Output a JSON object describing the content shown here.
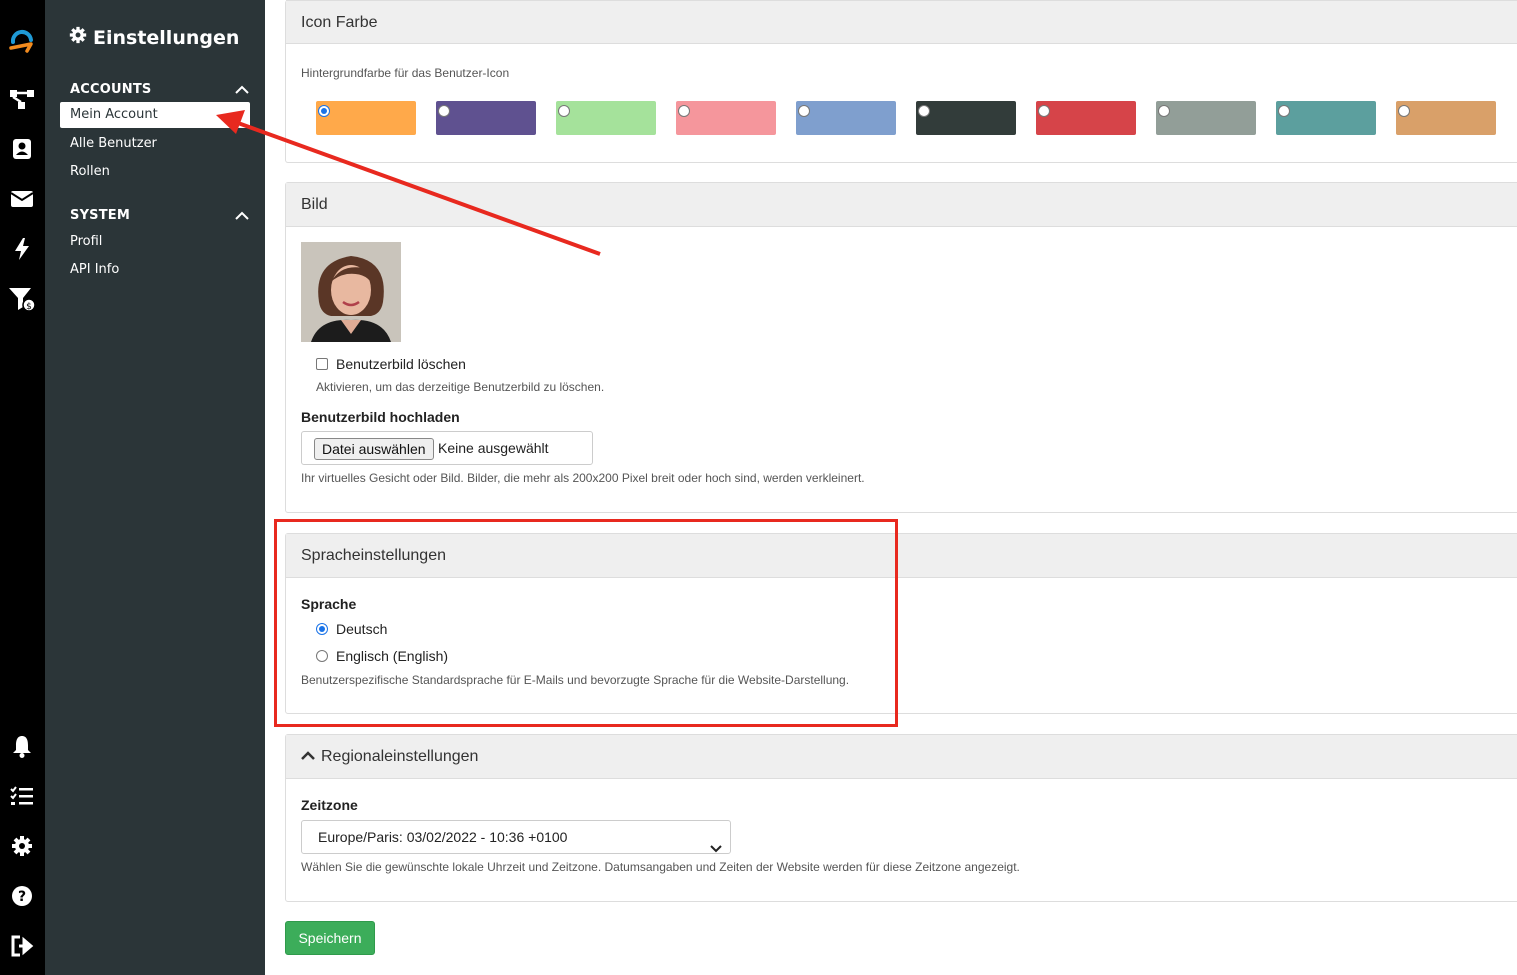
{
  "rail": {
    "icons": [
      "logo-icon",
      "workflow-icon",
      "contacts-icon",
      "mail-icon",
      "lightning-icon",
      "funnel-money-icon",
      "bell-icon",
      "checklist-icon",
      "gear-icon",
      "help-icon",
      "logout-icon"
    ]
  },
  "sidebar": {
    "title": "Einstellungen",
    "sections": [
      {
        "label": "ACCOUNTS",
        "items": [
          "Mein Account",
          "Alle Benutzer",
          "Rollen"
        ]
      },
      {
        "label": "SYSTEM",
        "items": [
          "Profil",
          "API Info"
        ]
      }
    ]
  },
  "icon_color": {
    "header": "Icon Farbe",
    "label": "Hintergrundfarbe für das Benutzer-Icon",
    "selected_index": 0,
    "swatches": [
      "#ffa94a",
      "#5f5190",
      "#a5e29b",
      "#f5969c",
      "#7f9fce",
      "#323c3a",
      "#d64449",
      "#929e98",
      "#5c9f9e",
      "#d9a069"
    ]
  },
  "image": {
    "header": "Bild",
    "delete_label": "Benutzerbild löschen",
    "delete_help": "Aktivieren, um das derzeitige Benutzerbild zu löschen.",
    "upload_label": "Benutzerbild hochladen",
    "file_button": "Datei auswählen",
    "file_status": "Keine ausgewählt",
    "upload_help": "Ihr virtuelles Gesicht oder Bild. Bilder, die mehr als 200x200 Pixel breit oder hoch sind, werden verkleinert."
  },
  "language": {
    "header": "Spracheinstellungen",
    "label": "Sprache",
    "options": [
      "Deutsch",
      "Englisch (English)"
    ],
    "selected": "Deutsch",
    "help": "Benutzerspezifische Standardsprache für E-Mails und bevorzugte Sprache für die Website-Darstellung."
  },
  "regional": {
    "header": "Regionaleinstellungen",
    "timezone_label": "Zeitzone",
    "timezone_value": "Europe/Paris: 03/02/2022 - 10:36 +0100",
    "help": "Wählen Sie die gewünschte lokale Uhrzeit und Zeitzone. Datumsangaben und Zeiten der Website werden für diese Zeitzone angezeigt."
  },
  "save_label": "Speichern",
  "colors": {
    "rail_bg": "#000000",
    "sidebar_bg": "#2b3538",
    "save_green": "#3cad5a",
    "annotation_red": "#e8291f",
    "logo_blue": "#1f9ad6",
    "logo_orange": "#f28b1e"
  }
}
